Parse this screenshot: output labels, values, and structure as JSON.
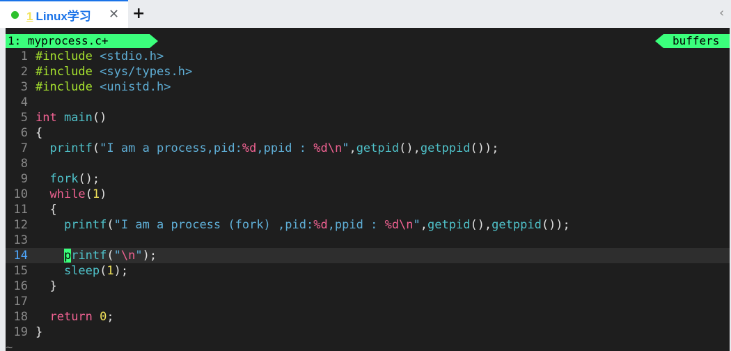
{
  "tab": {
    "number": "1",
    "title": "Linux学习",
    "close_glyph": "✕",
    "new_tab_glyph": "+",
    "overflow_glyph": "‹"
  },
  "buffer": {
    "left_label": "1: myprocess.c+",
    "right_label": "buffers"
  },
  "editor": {
    "current_line": 14,
    "lines": [
      {
        "n": "1",
        "tokens": [
          [
            "pp",
            "#include "
          ],
          [
            "hdr",
            "<stdio.h>"
          ]
        ]
      },
      {
        "n": "2",
        "tokens": [
          [
            "pp",
            "#include "
          ],
          [
            "hdr",
            "<sys/types.h>"
          ]
        ]
      },
      {
        "n": "3",
        "tokens": [
          [
            "pp",
            "#include "
          ],
          [
            "hdr",
            "<unistd.h>"
          ]
        ]
      },
      {
        "n": "4",
        "tokens": []
      },
      {
        "n": "5",
        "tokens": [
          [
            "kw",
            "int "
          ],
          [
            "fn",
            "main"
          ],
          [
            "pun",
            "()"
          ]
        ]
      },
      {
        "n": "6",
        "tokens": [
          [
            "pun",
            "{"
          ]
        ]
      },
      {
        "n": "7",
        "tokens": [
          [
            "pun",
            "  "
          ],
          [
            "fn",
            "printf"
          ],
          [
            "pun",
            "("
          ],
          [
            "str",
            "\"I am a process,pid:"
          ],
          [
            "fmt",
            "%d"
          ],
          [
            "str",
            ",ppid : "
          ],
          [
            "fmt",
            "%d\\n"
          ],
          [
            "str",
            "\""
          ],
          [
            "pun",
            ","
          ],
          [
            "fn",
            "getpid"
          ],
          [
            "pun",
            "(),"
          ],
          [
            "fn",
            "getppid"
          ],
          [
            "pun",
            "());"
          ]
        ]
      },
      {
        "n": "8",
        "tokens": []
      },
      {
        "n": "9",
        "tokens": [
          [
            "pun",
            "  "
          ],
          [
            "fn",
            "fork"
          ],
          [
            "pun",
            "();"
          ]
        ]
      },
      {
        "n": "10",
        "tokens": [
          [
            "pun",
            "  "
          ],
          [
            "kw",
            "while"
          ],
          [
            "pun",
            "("
          ],
          [
            "num",
            "1"
          ],
          [
            "pun",
            ")"
          ]
        ]
      },
      {
        "n": "11",
        "tokens": [
          [
            "pun",
            "  {"
          ]
        ]
      },
      {
        "n": "12",
        "tokens": [
          [
            "pun",
            "    "
          ],
          [
            "fn",
            "printf"
          ],
          [
            "pun",
            "("
          ],
          [
            "str",
            "\"I am a process (fork) ,pid:"
          ],
          [
            "fmt",
            "%d"
          ],
          [
            "str",
            ",ppid : "
          ],
          [
            "fmt",
            "%d\\n"
          ],
          [
            "str",
            "\""
          ],
          [
            "pun",
            ","
          ],
          [
            "fn",
            "getpid"
          ],
          [
            "pun",
            "(),"
          ],
          [
            "fn",
            "getppid"
          ],
          [
            "pun",
            "());"
          ]
        ]
      },
      {
        "n": "13",
        "tokens": []
      },
      {
        "n": "14",
        "tokens": [
          [
            "pun",
            "    "
          ],
          [
            "cursor",
            "p"
          ],
          [
            "fn",
            "rintf"
          ],
          [
            "pun",
            "("
          ],
          [
            "str",
            "\""
          ],
          [
            "fmt",
            "\\n"
          ],
          [
            "str",
            "\""
          ],
          [
            "pun",
            ");"
          ]
        ]
      },
      {
        "n": "15",
        "tokens": [
          [
            "pun",
            "    "
          ],
          [
            "fn",
            "sleep"
          ],
          [
            "pun",
            "("
          ],
          [
            "num",
            "1"
          ],
          [
            "pun",
            ");"
          ]
        ]
      },
      {
        "n": "16",
        "tokens": [
          [
            "pun",
            "  }"
          ]
        ]
      },
      {
        "n": "17",
        "tokens": []
      },
      {
        "n": "18",
        "tokens": [
          [
            "pun",
            "  "
          ],
          [
            "kw",
            "return "
          ],
          [
            "num",
            "0"
          ],
          [
            "pun",
            ";"
          ]
        ]
      },
      {
        "n": "19",
        "tokens": [
          [
            "pun",
            "}"
          ]
        ]
      }
    ],
    "empty_marker": "~"
  }
}
